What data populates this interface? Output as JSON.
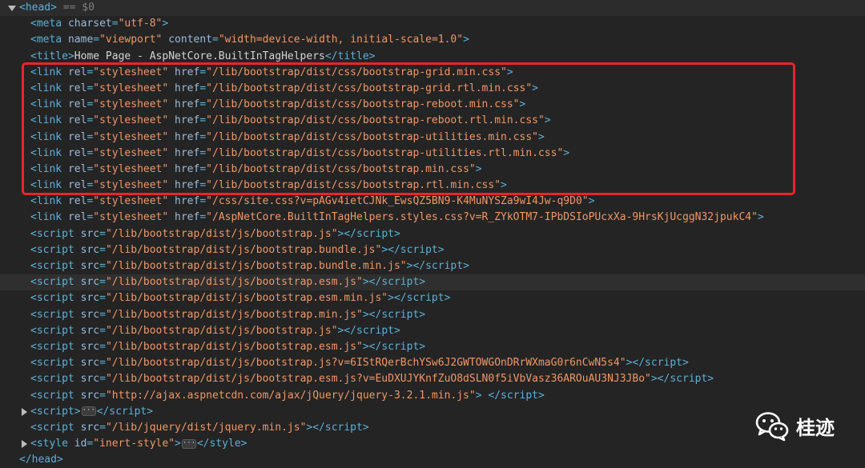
{
  "devtools": {
    "head_marker": "== $0",
    "lines": [
      {
        "indent": 0,
        "toggle": "down",
        "html": "<span class='tag'>&lt;head&gt;</span> <span class='eq'>{{head_marker}}</span>"
      },
      {
        "indent": 1,
        "html": "<span class='tag'>&lt;meta</span> <span class='attr'>charset</span><span class='tag'>=</span><span class='val'>\"utf-8\"</span><span class='tag'>&gt;</span>"
      },
      {
        "indent": 1,
        "html": "<span class='tag'>&lt;meta</span> <span class='attr'>name</span><span class='tag'>=</span><span class='val'>\"viewport\"</span> <span class='attr'>content</span><span class='tag'>=</span><span class='val'>\"width=device-width, initial-scale=1.0\"</span><span class='tag'>&gt;</span>"
      },
      {
        "indent": 1,
        "html": "<span class='tag'>&lt;title&gt;</span><span class='txt'>Home Page - AspNetCore.BuiltInTagHelpers</span><span class='tag'>&lt;/title&gt;</span>"
      },
      {
        "indent": 1,
        "html": "<span class='tag'>&lt;link</span> <span class='attr'>rel</span><span class='tag'>=</span><span class='val'>\"stylesheet\"</span> <span class='attr'>href</span><span class='tag'>=</span><span class='val'>\"/lib/bootstrap/dist/css/bootstrap-grid.min.css\"</span><span class='tag'>&gt;</span>"
      },
      {
        "indent": 1,
        "html": "<span class='tag'>&lt;link</span> <span class='attr'>rel</span><span class='tag'>=</span><span class='val'>\"stylesheet\"</span> <span class='attr'>href</span><span class='tag'>=</span><span class='val'>\"/lib/bootstrap/dist/css/bootstrap-grid.rtl.min.css\"</span><span class='tag'>&gt;</span>"
      },
      {
        "indent": 1,
        "html": "<span class='tag'>&lt;link</span> <span class='attr'>rel</span><span class='tag'>=</span><span class='val'>\"stylesheet\"</span> <span class='attr'>href</span><span class='tag'>=</span><span class='val'>\"/lib/bootstrap/dist/css/bootstrap-reboot.min.css\"</span><span class='tag'>&gt;</span>"
      },
      {
        "indent": 1,
        "html": "<span class='tag'>&lt;link</span> <span class='attr'>rel</span><span class='tag'>=</span><span class='val'>\"stylesheet\"</span> <span class='attr'>href</span><span class='tag'>=</span><span class='val'>\"/lib/bootstrap/dist/css/bootstrap-reboot.rtl.min.css\"</span><span class='tag'>&gt;</span>"
      },
      {
        "indent": 1,
        "html": "<span class='tag'>&lt;link</span> <span class='attr'>rel</span><span class='tag'>=</span><span class='val'>\"stylesheet\"</span> <span class='attr'>href</span><span class='tag'>=</span><span class='val'>\"/lib/bootstrap/dist/css/bootstrap-utilities.min.css\"</span><span class='tag'>&gt;</span>"
      },
      {
        "indent": 1,
        "html": "<span class='tag'>&lt;link</span> <span class='attr'>rel</span><span class='tag'>=</span><span class='val'>\"stylesheet\"</span> <span class='attr'>href</span><span class='tag'>=</span><span class='val'>\"/lib/bootstrap/dist/css/bootstrap-utilities.rtl.min.css\"</span><span class='tag'>&gt;</span>"
      },
      {
        "indent": 1,
        "html": "<span class='tag'>&lt;link</span> <span class='attr'>rel</span><span class='tag'>=</span><span class='val'>\"stylesheet\"</span> <span class='attr'>href</span><span class='tag'>=</span><span class='val'>\"/lib/bootstrap/dist/css/bootstrap.min.css\"</span><span class='tag'>&gt;</span>"
      },
      {
        "indent": 1,
        "html": "<span class='tag'>&lt;link</span> <span class='attr'>rel</span><span class='tag'>=</span><span class='val'>\"stylesheet\"</span> <span class='attr'>href</span><span class='tag'>=</span><span class='val'>\"/lib/bootstrap/dist/css/bootstrap.rtl.min.css\"</span><span class='tag'>&gt;</span>"
      },
      {
        "indent": 1,
        "html": "<span class='tag'>&lt;link</span> <span class='attr'>rel</span><span class='tag'>=</span><span class='val'>\"stylesheet\"</span> <span class='attr'>href</span><span class='tag'>=</span><span class='val'>\"/css/site.css?v=pAGv4ietCJNk_EwsQZ5BN9-K4MuNYSZa9wI4Jw-q9D0\"</span><span class='tag'>&gt;</span>"
      },
      {
        "indent": 1,
        "html": "<span class='tag'>&lt;link</span> <span class='attr'>rel</span><span class='tag'>=</span><span class='val'>\"stylesheet\"</span> <span class='attr'>href</span><span class='tag'>=</span><span class='val'>\"/AspNetCore.BuiltInTagHelpers.styles.css?v=R_ZYkOTM7-IPbDSIoPUcxXa-9HrsKjUcggN32jpukC4\"</span><span class='tag'>&gt;</span>"
      },
      {
        "indent": 1,
        "html": "<span class='tag'>&lt;script</span> <span class='attr'>src</span><span class='tag'>=</span><span class='val'>\"/lib/bootstrap/dist/js/bootstrap.js\"</span><span class='tag'>&gt;&lt;/script&gt;</span>"
      },
      {
        "indent": 1,
        "html": "<span class='tag'>&lt;script</span> <span class='attr'>src</span><span class='tag'>=</span><span class='val'>\"/lib/bootstrap/dist/js/bootstrap.bundle.js\"</span><span class='tag'>&gt;&lt;/script&gt;</span>"
      },
      {
        "indent": 1,
        "html": "<span class='tag'>&lt;script</span> <span class='attr'>src</span><span class='tag'>=</span><span class='val'>\"/lib/bootstrap/dist/js/bootstrap.bundle.min.js\"</span><span class='tag'>&gt;&lt;/script&gt;</span>"
      },
      {
        "indent": 1,
        "highlight": true,
        "html": "<span class='tag'>&lt;script</span> <span class='attr'>src</span><span class='tag'>=</span><span class='val'>\"/lib/bootstrap/dist/js/bootstrap.esm.js\"</span><span class='tag'>&gt;&lt;/script&gt;</span>"
      },
      {
        "indent": 1,
        "html": "<span class='tag'>&lt;script</span> <span class='attr'>src</span><span class='tag'>=</span><span class='val'>\"/lib/bootstrap/dist/js/bootstrap.esm.min.js\"</span><span class='tag'>&gt;&lt;/script&gt;</span>"
      },
      {
        "indent": 1,
        "html": "<span class='tag'>&lt;script</span> <span class='attr'>src</span><span class='tag'>=</span><span class='val'>\"/lib/bootstrap/dist/js/bootstrap.min.js\"</span><span class='tag'>&gt;&lt;/script&gt;</span>"
      },
      {
        "indent": 1,
        "html": "<span class='tag'>&lt;script</span> <span class='attr'>src</span><span class='tag'>=</span><span class='val'>\"/lib/bootstrap/dist/js/bootstrap.js\"</span><span class='tag'>&gt;&lt;/script&gt;</span>"
      },
      {
        "indent": 1,
        "html": "<span class='tag'>&lt;script</span> <span class='attr'>src</span><span class='tag'>=</span><span class='val'>\"/lib/bootstrap/dist/js/bootstrap.esm.js\"</span><span class='tag'>&gt;&lt;/script&gt;</span>"
      },
      {
        "indent": 1,
        "html": "<span class='tag'>&lt;script</span> <span class='attr'>src</span><span class='tag'>=</span><span class='val'>\"/lib/bootstrap/dist/js/bootstrap.js?v=6IStRQerBchYSw6J2GWTOWGOnDRrWXmaG0r6nCwN5s4\"</span><span class='tag'>&gt;&lt;/script&gt;</span>"
      },
      {
        "indent": 1,
        "html": "<span class='tag'>&lt;script</span> <span class='attr'>src</span><span class='tag'>=</span><span class='val'>\"/lib/bootstrap/dist/js/bootstrap.esm.js?v=EuDXUJYKnfZuO8dSLN0f5iVbVasz36AROuAU3NJ3JBo\"</span><span class='tag'>&gt;&lt;/script&gt;</span>"
      },
      {
        "indent": 1,
        "html": "<span class='tag'>&lt;script</span> <span class='attr'>src</span><span class='tag'>=</span><span class='val'>\"http://ajax.aspnetcdn.com/ajax/jQuery/jquery-3.2.1.min.js\"</span><span class='tag'>&gt;</span> <span class='tag'>&lt;/script&gt;</span>"
      },
      {
        "indent": 1,
        "toggle": "right",
        "html": "<span class='tag'>&lt;script&gt;</span><span class='ell'>&middot;&middot;&middot;</span><span class='tag'>&lt;/script&gt;</span>"
      },
      {
        "indent": 1,
        "html": "<span class='tag'>&lt;script</span> <span class='attr'>src</span><span class='tag'>=</span><span class='val'>\"/lib/jquery/dist/jquery.min.js\"</span><span class='tag'>&gt;&lt;/script&gt;</span>"
      },
      {
        "indent": 1,
        "toggle": "right",
        "html": "<span class='tag'>&lt;style</span> <span class='attr'>id</span><span class='tag'>=</span><span class='val'>\"inert-style\"</span><span class='tag'>&gt;</span><span class='ell'>&middot;&middot;&middot;</span><span class='tag'>&lt;/style&gt;</span>"
      },
      {
        "indent": 0,
        "html": "<span class='tag'>&lt;/head&gt;</span>"
      }
    ]
  },
  "watermark": {
    "text": "桂迹"
  }
}
